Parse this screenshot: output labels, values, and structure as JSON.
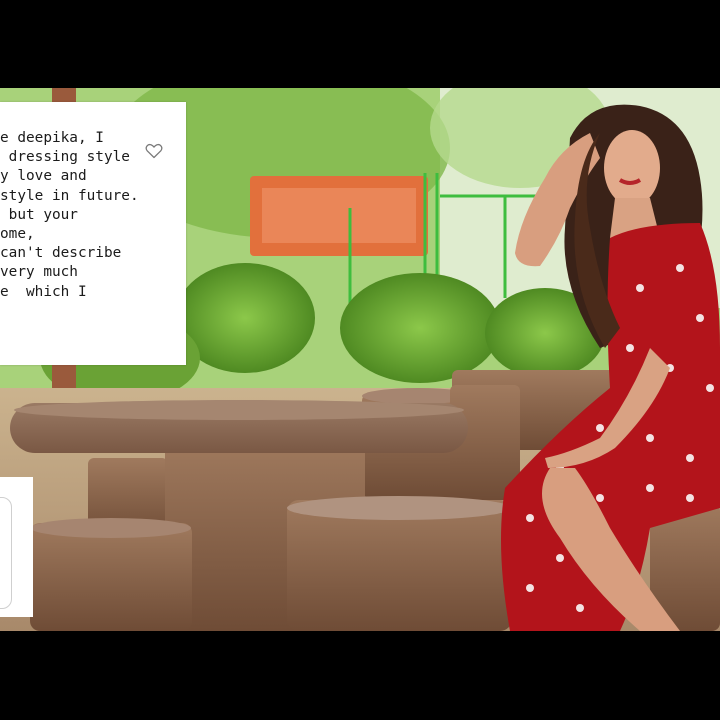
{
  "comment": {
    "lines": [
      "e deepika, I",
      " dressing style",
      "y love and",
      "style in future.",
      " but your",
      "ome,",
      "can't describe",
      "very much",
      "e  which I"
    ],
    "like_icon": "heart-outline-icon"
  },
  "colors": {
    "dress": "#b3141b",
    "card": "#ffffff",
    "letterbox": "#000000"
  }
}
